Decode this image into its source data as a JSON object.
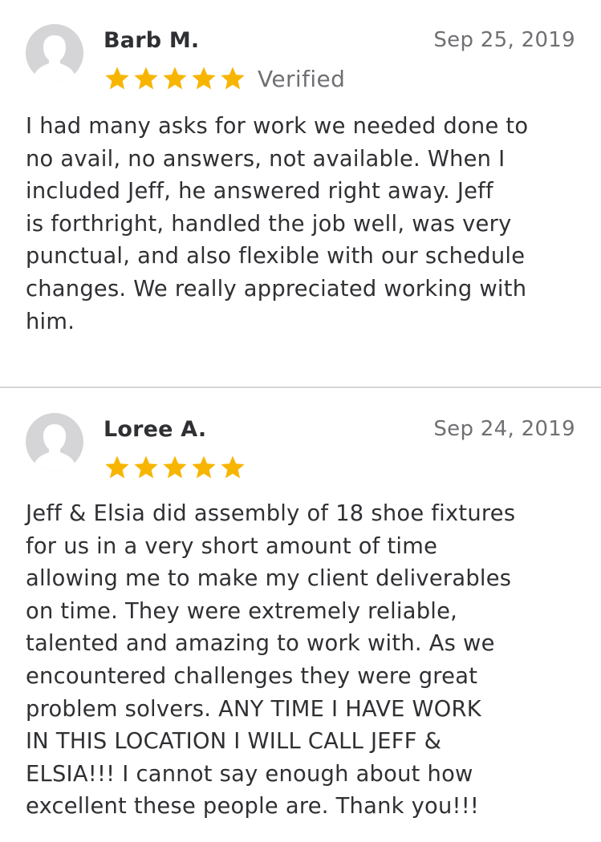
{
  "reviews": [
    {
      "name": "Barb M.",
      "date": "Sep 25, 2019",
      "rating": 5,
      "verified_label": "Verified",
      "text": "I had many asks for work we needed done to\nno avail, no answers, not available. When I\nincluded Jeff, he answered right away. Jeff\nis forthright, handled the job well, was very\npunctual, and also flexible with our schedule\nchanges. We really appreciated working with\nhim."
    },
    {
      "name": "Loree A.",
      "date": "Sep 24, 2019",
      "rating": 5,
      "text": "Jeff & Elsia did assembly of 18 shoe fixtures\nfor us in a very short amount of time\nallowing me to make my client deliverables\non time.  They were extremely reliable,\ntalented and amazing to work with. As we\nencountered challenges they were great\nproblem solvers. ANY TIME I HAVE WORK\nIN THIS LOCATION I WILL CALL JEFF &\nELSIA!!! I cannot say enough about how\nexcellent these people are. Thank you!!!"
    }
  ],
  "colors": {
    "star": "#f7b500",
    "avatar_bg": "#d5d5d7",
    "avatar_figure": "#ffffff",
    "divider": "#d6d6d6",
    "muted_text": "#6f7073",
    "primary_text": "#2f3033"
  },
  "icons": {
    "avatar": "user-silhouette-icon",
    "star": "star-icon"
  }
}
